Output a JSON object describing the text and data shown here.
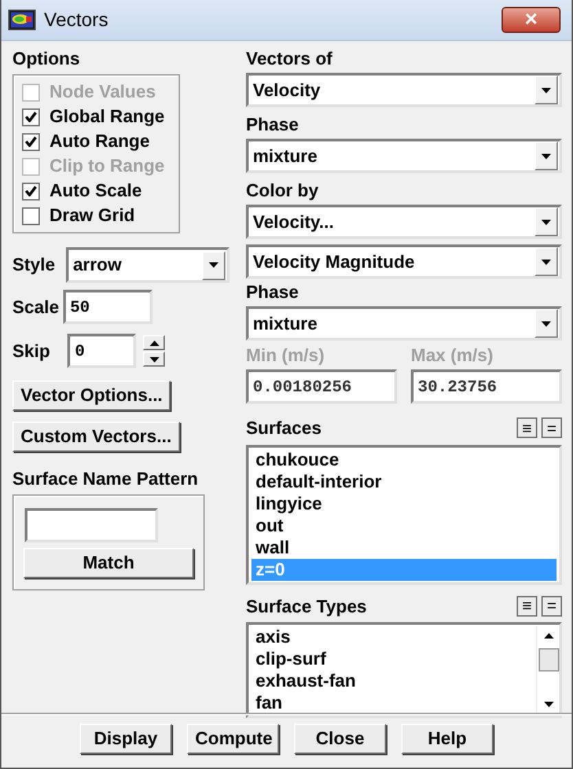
{
  "window": {
    "title": "Vectors",
    "close": "×"
  },
  "options": {
    "label": "Options",
    "items": [
      {
        "label": "Node Values",
        "checked": false,
        "disabled": true
      },
      {
        "label": "Global Range",
        "checked": true,
        "disabled": false
      },
      {
        "label": "Auto Range",
        "checked": true,
        "disabled": false
      },
      {
        "label": "Clip to Range",
        "checked": false,
        "disabled": true
      },
      {
        "label": "Auto Scale",
        "checked": true,
        "disabled": false
      },
      {
        "label": "Draw Grid",
        "checked": false,
        "disabled": false
      }
    ]
  },
  "style": {
    "label": "Style",
    "value": "arrow"
  },
  "scale": {
    "label": "Scale",
    "value": "50"
  },
  "skip": {
    "label": "Skip",
    "value": "0"
  },
  "side_buttons": [
    "Vector Options...",
    "Custom Vectors..."
  ],
  "surface_name_pattern": {
    "label": "Surface Name Pattern",
    "button": "Match"
  },
  "vectors_of": {
    "label": "Vectors of",
    "value": "Velocity"
  },
  "phase": {
    "label": "Phase",
    "value": "mixture"
  },
  "color_by": {
    "label": "Color by",
    "value": "Velocity...",
    "component": "Velocity Magnitude"
  },
  "color_phase": {
    "label": "Phase",
    "value": "mixture"
  },
  "range": [
    {
      "label": "Min (m/s)",
      "value": "0.00180256",
      "disabled": true
    },
    {
      "label": "Max (m/s)",
      "value": "30.23756",
      "disabled": true
    }
  ],
  "surfaces": {
    "label": "Surfaces",
    "header_buttons": [
      "≡",
      "="
    ],
    "items": [
      {
        "label": "chukouce",
        "selected": false
      },
      {
        "label": "default-interior",
        "selected": false
      },
      {
        "label": "lingyice",
        "selected": false
      },
      {
        "label": "out",
        "selected": false
      },
      {
        "label": "wall",
        "selected": false
      },
      {
        "label": "z=0",
        "selected": true
      }
    ]
  },
  "surface_types": {
    "label": "Surface Types",
    "header_buttons": [
      "≡",
      "="
    ],
    "items": [
      {
        "label": "axis",
        "selected": false
      },
      {
        "label": "clip-surf",
        "selected": false
      },
      {
        "label": "exhaust-fan",
        "selected": false
      },
      {
        "label": "fan",
        "selected": false
      }
    ]
  },
  "buttons": [
    "Display",
    "Compute",
    "Close",
    "Help"
  ]
}
